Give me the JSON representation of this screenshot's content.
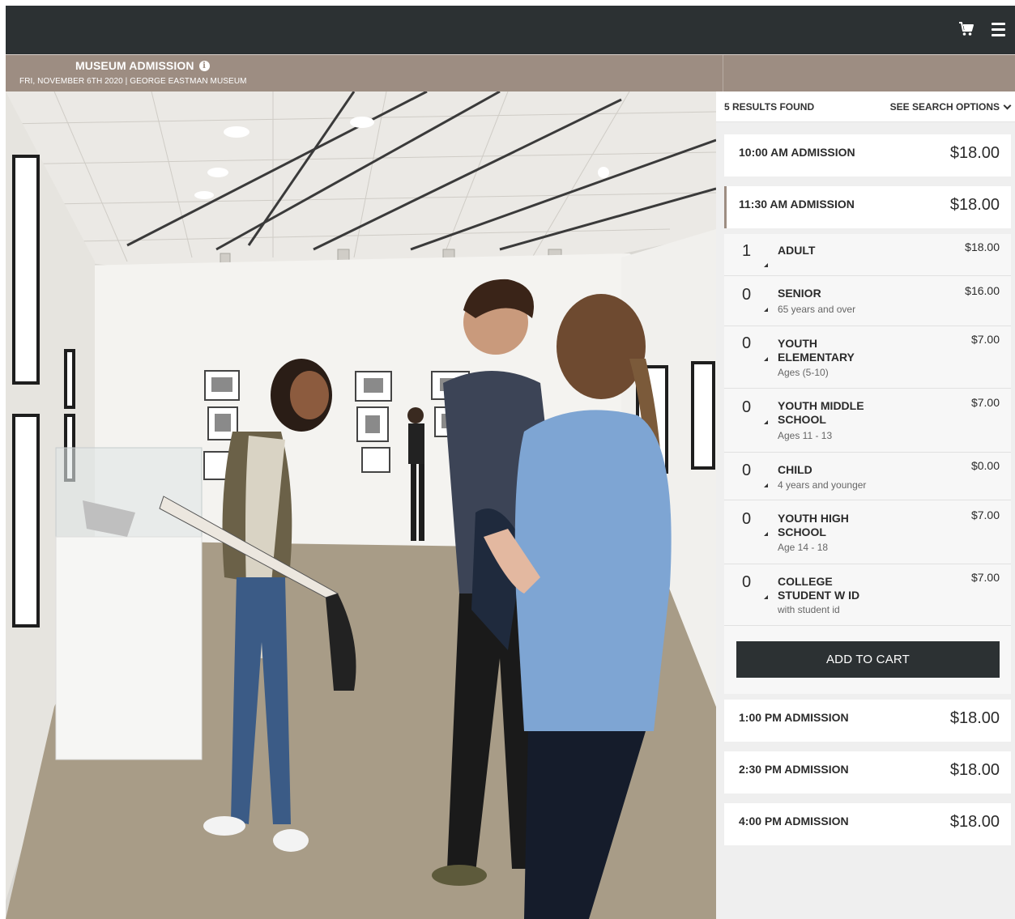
{
  "header": {
    "cart_icon": "shopping-cart-icon",
    "menu_icon": "hamburger-menu-icon"
  },
  "event": {
    "title": "MUSEUM ADMISSION",
    "info_icon": "info-icon",
    "subtitle": "FRI, NOVEMBER 6TH 2020 | GEORGE EASTMAN MUSEUM"
  },
  "results": {
    "count": "5 RESULTS FOUND",
    "search_options": "SEE SEARCH OPTIONS"
  },
  "slots": [
    {
      "label": "10:00 AM ADMISSION",
      "price": "$18.00"
    },
    {
      "label": "11:30 AM ADMISSION",
      "price": "$18.00"
    },
    {
      "label": "1:00 PM ADMISSION",
      "price": "$18.00"
    },
    {
      "label": "2:30 PM ADMISSION",
      "price": "$18.00"
    },
    {
      "label": "4:00 PM ADMISSION",
      "price": "$18.00"
    }
  ],
  "tickets": [
    {
      "qty": "1",
      "name": "ADULT",
      "desc": "",
      "price": "$18.00"
    },
    {
      "qty": "0",
      "name": "SENIOR",
      "desc": "65 years and over",
      "price": "$16.00"
    },
    {
      "qty": "0",
      "name": "YOUTH\nELEMENTARY",
      "desc": "Ages (5-10)",
      "price": "$7.00"
    },
    {
      "qty": "0",
      "name": "YOUTH MIDDLE\nSCHOOL",
      "desc": "Ages 11 - 13",
      "price": "$7.00"
    },
    {
      "qty": "0",
      "name": "CHILD",
      "desc": "4 years and younger",
      "price": "$0.00"
    },
    {
      "qty": "0",
      "name": "YOUTH HIGH\nSCHOOL",
      "desc": "Age 14 - 18",
      "price": "$7.00"
    },
    {
      "qty": "0",
      "name": "COLLEGE\nSTUDENT W ID",
      "desc": "with student id",
      "price": "$7.00"
    }
  ],
  "cart": {
    "add_label": "ADD TO CART"
  }
}
